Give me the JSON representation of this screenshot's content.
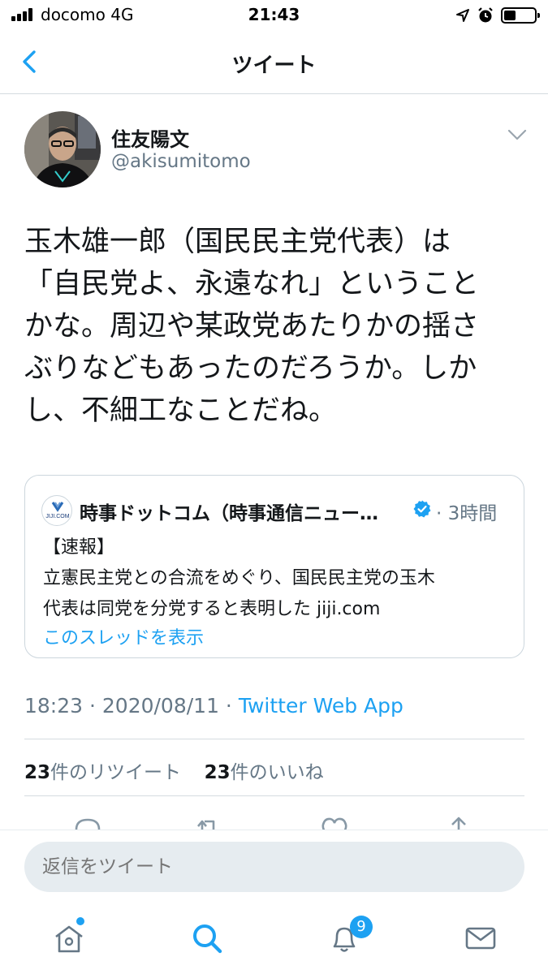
{
  "status_bar": {
    "carrier": "docomo   4G",
    "time": "21:43",
    "icons": [
      "signal-icon",
      "location-icon",
      "alarm-icon",
      "battery-icon"
    ]
  },
  "header": {
    "title": "ツイート",
    "back_icon": "chevron-left-icon"
  },
  "tweet": {
    "author_name": "住友陽文",
    "author_handle": "@akisumitomo",
    "text": "玉木雄一郎（国民民主党代表）は\n「自民党よ、永遠なれ」ということ\nかな。周辺や某政党あたりかの揺さ\nぶりなどもあったのだろうか。しか\nし、不細工なことだね。",
    "time": "18:23 · 2020/08/11 · ",
    "source": "Twitter Web App",
    "retweet_count": "23",
    "retweet_label": "件のリツイート",
    "like_count": "23",
    "like_label": "件のいいね"
  },
  "quote": {
    "logo_text": "JIJI.COM",
    "name": "時事ドットコム（時事通信ニュー…",
    "time": "· 3時間",
    "body": "【速報】\n 立憲民主党との合流をめぐり、国民民主党の玉木\n代表は同党を分党すると表明した jiji.com",
    "thread_link": "このスレッドを表示"
  },
  "reply": {
    "placeholder": "返信をツイート"
  },
  "tab_bar": {
    "items": [
      "home-icon",
      "search-icon",
      "notifications-icon",
      "messages-icon"
    ],
    "notification_badge": "9"
  },
  "colors": {
    "accent": "#1da1f2",
    "secondary_text": "#657786",
    "divider": "#d5dbe0"
  }
}
